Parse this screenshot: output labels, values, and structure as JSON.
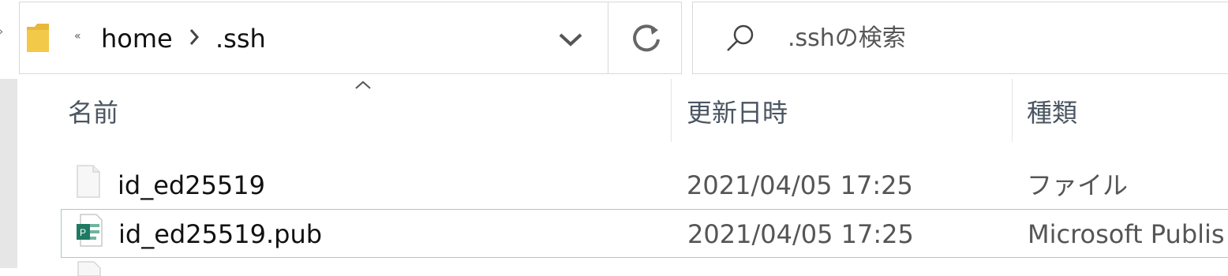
{
  "address_bar": {
    "overflow": "«",
    "breadcrumbs": [
      "home",
      ".ssh"
    ]
  },
  "search": {
    "placeholder": ".sshの検索"
  },
  "columns": {
    "name": "名前",
    "modified": "更新日時",
    "type": "種類"
  },
  "files": [
    {
      "name": "id_ed25519",
      "modified": "2021/04/05 17:25",
      "type": "ファイル",
      "icon": "blank-file-icon",
      "selected": false
    },
    {
      "name": "id_ed25519.pub",
      "modified": "2021/04/05 17:25",
      "type": "Microsoft Publis",
      "icon": "publisher-file-icon",
      "selected": true
    }
  ],
  "colors": {
    "selection_border": "#99d1c8",
    "header_text": "#4a5561",
    "folder_yellow": "#f3c94a",
    "publisher_green": "#1f7a63"
  }
}
